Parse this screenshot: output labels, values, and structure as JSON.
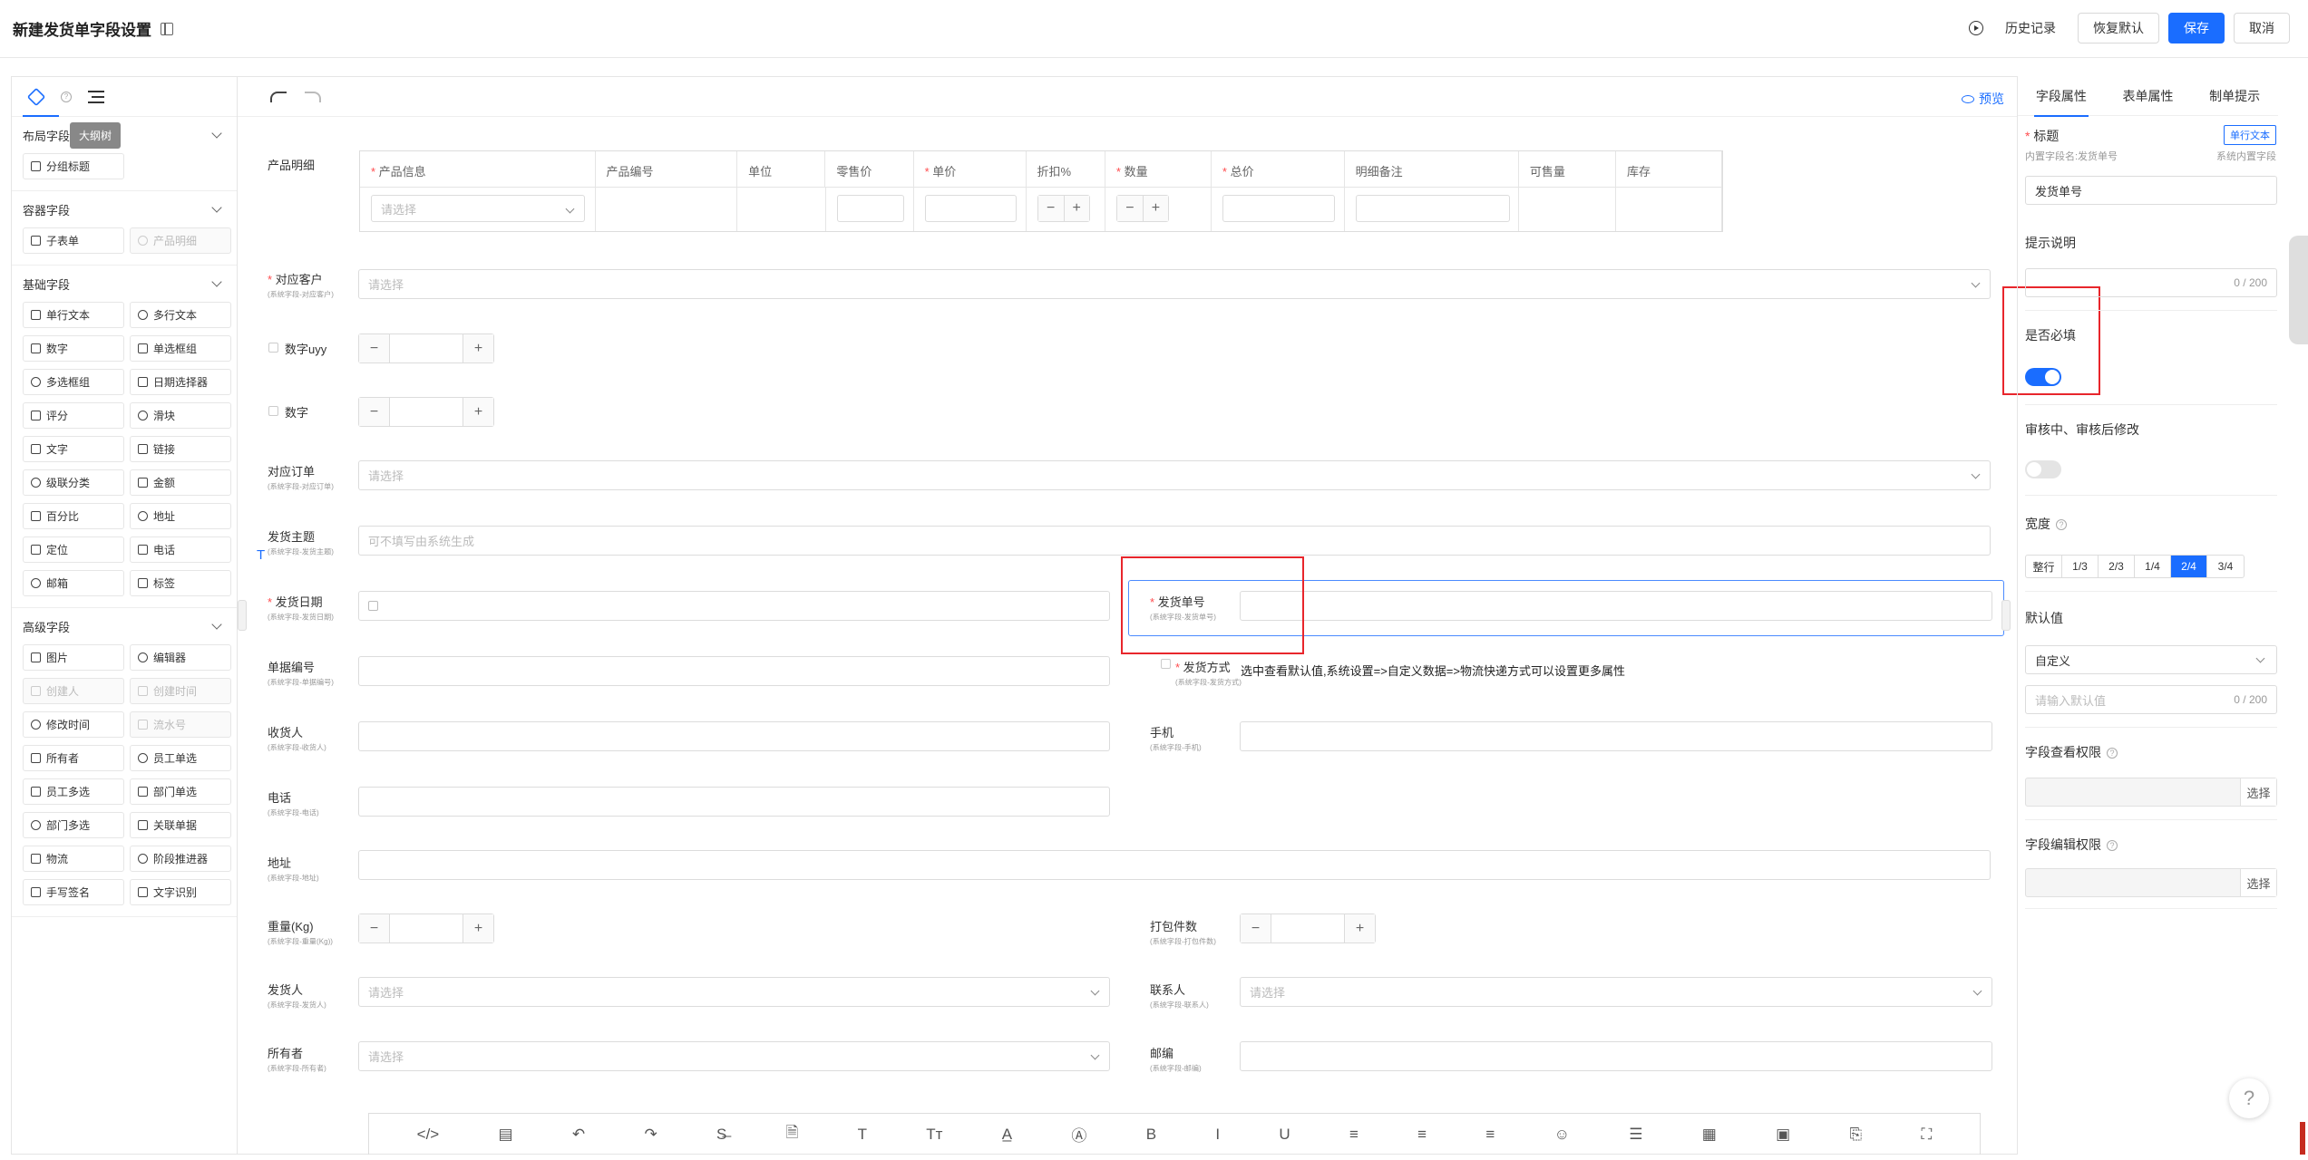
{
  "header": {
    "title": "新建发货单字段设置",
    "history": "历史记录",
    "restore": "恢复默认",
    "save": "保存",
    "cancel": "取消"
  },
  "left_panel": {
    "tooltip": "大纲树",
    "sections": [
      {
        "title": "布局字段",
        "items": [
          {
            "label": "分组标题",
            "disabled": false
          }
        ]
      },
      {
        "title": "容器字段",
        "items": [
          {
            "label": "子表单",
            "disabled": false
          },
          {
            "label": "产品明细",
            "disabled": true
          }
        ]
      },
      {
        "title": "基础字段",
        "items": [
          {
            "label": "单行文本"
          },
          {
            "label": "多行文本"
          },
          {
            "label": "数字"
          },
          {
            "label": "单选框组"
          },
          {
            "label": "多选框组"
          },
          {
            "label": "日期选择器"
          },
          {
            "label": "评分"
          },
          {
            "label": "滑块"
          },
          {
            "label": "文字"
          },
          {
            "label": "链接"
          },
          {
            "label": "级联分类"
          },
          {
            "label": "金额"
          },
          {
            "label": "百分比"
          },
          {
            "label": "地址"
          },
          {
            "label": "定位"
          },
          {
            "label": "电话"
          },
          {
            "label": "邮箱"
          },
          {
            "label": "标签"
          }
        ]
      },
      {
        "title": "高级字段",
        "items": [
          {
            "label": "图片"
          },
          {
            "label": "编辑器"
          },
          {
            "label": "创建人",
            "disabled": true
          },
          {
            "label": "创建时间",
            "disabled": true
          },
          {
            "label": "修改时间"
          },
          {
            "label": "流水号",
            "disabled": true
          },
          {
            "label": "所有者"
          },
          {
            "label": "员工单选"
          },
          {
            "label": "员工多选"
          },
          {
            "label": "部门单选"
          },
          {
            "label": "部门多选"
          },
          {
            "label": "关联单据"
          },
          {
            "label": "物流"
          },
          {
            "label": "阶段推进器"
          },
          {
            "label": "手写签名"
          },
          {
            "label": "文字识别"
          }
        ]
      }
    ]
  },
  "canvas": {
    "preview": "预览",
    "product_label": "产品明细",
    "product_columns": [
      "产品信息",
      "产品编号",
      "单位",
      "零售价",
      "单价",
      "折扣%",
      "数量",
      "总价",
      "明细备注",
      "可售量",
      "库存"
    ],
    "select_placeholder": "请选择",
    "text_cursor": "T",
    "fields": {
      "customer": {
        "label": "对应客户",
        "sub": "(系统字段-对应客户)",
        "placeholder": "请选择"
      },
      "num_uyy": {
        "label": "数字uyy"
      },
      "num": {
        "label": "数字"
      },
      "order": {
        "label": "对应订单",
        "sub": "(系统字段-对应订单)",
        "placeholder": "请选择"
      },
      "subject": {
        "label": "发货主题",
        "sub": "(系统字段-发货主题)",
        "placeholder": "可不填写由系统生成"
      },
      "ship_date": {
        "label": "发货日期",
        "sub": "(系统字段-发货日期)"
      },
      "ship_no": {
        "label": "发货单号",
        "sub": "(系统字段-发货单号)"
      },
      "doc_no": {
        "label": "单据编号",
        "sub": "(系统字段-单据编号)"
      },
      "ship_method": {
        "label": "发货方式",
        "sub": "(系统字段-发货方式)",
        "hint": "选中查看默认值,系统设置=>自定义数据=>物流快递方式可以设置更多属性"
      },
      "receiver": {
        "label": "收货人",
        "sub": "(系统字段-收货人)"
      },
      "mobile": {
        "label": "手机",
        "sub": "(系统字段-手机)"
      },
      "phone": {
        "label": "电话",
        "sub": "(系统字段-电话)"
      },
      "address": {
        "label": "地址",
        "sub": "(系统字段-地址)"
      },
      "weight": {
        "label": "重量(Kg)",
        "sub": "(系统字段-重量(Kg))"
      },
      "packages": {
        "label": "打包件数",
        "sub": "(系统字段-打包件数)"
      },
      "shipper": {
        "label": "发货人",
        "sub": "(系统字段-发货人)",
        "placeholder": "请选择"
      },
      "contact": {
        "label": "联系人",
        "sub": "(系统字段-联系人)",
        "placeholder": "请选择"
      },
      "owner": {
        "label": "所有者",
        "sub": "(系统字段-所有者)",
        "placeholder": "请选择"
      },
      "zip": {
        "label": "邮编",
        "sub": "(系统字段-邮编)"
      }
    },
    "editor_tools": [
      "</>",
      "▤",
      "↶",
      "↷",
      "S̶",
      "🗎",
      "T",
      "Tт",
      "A̲",
      "Ⓐ",
      "B",
      "I",
      "U",
      "≡",
      "≡",
      "≡",
      "☺",
      "☰",
      "▦",
      "▣",
      "⎘",
      "⛶"
    ]
  },
  "right_panel": {
    "tabs": [
      "字段属性",
      "表单属性",
      "制单提示"
    ],
    "title_label": "标题",
    "field_type_tag": "单行文本",
    "internal_name": "内置字段名:发货单号",
    "system_field": "系统内置字段",
    "title_value": "发货单号",
    "hint_label": "提示说明",
    "hint_count": "0 / 200",
    "required_label": "是否必填",
    "required_on": true,
    "edit_label": "审核中、审核后修改",
    "edit_on": false,
    "width_label": "宽度",
    "width_options": [
      "整行",
      "1/3",
      "2/3",
      "1/4",
      "2/4",
      "3/4"
    ],
    "width_active": "2/4",
    "default_label": "默认值",
    "default_type": "自定义",
    "default_placeholder": "请输入默认值",
    "default_count": "0 / 200",
    "view_perm_label": "字段查看权限",
    "edit_perm_label": "字段编辑权限",
    "select_btn": "选择"
  },
  "help_button": "?"
}
